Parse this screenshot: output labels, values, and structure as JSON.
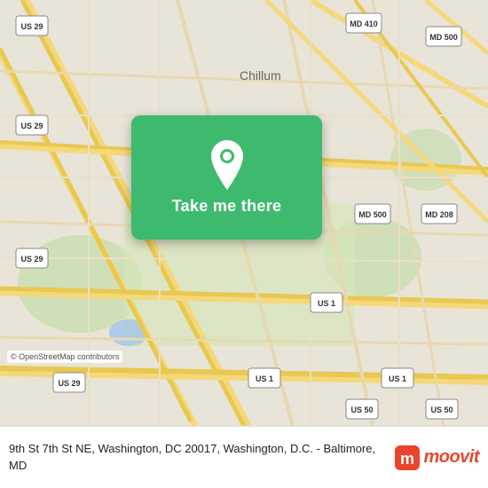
{
  "map": {
    "attribution": "© OpenStreetMap contributors",
    "center_lat": 38.93,
    "center_lng": -77.01
  },
  "card": {
    "button_label": "Take me there",
    "pin_icon": "location-pin"
  },
  "info_bar": {
    "address": "9th St 7th St NE, Washington, DC 20017, Washington, D.C. - Baltimore, MD",
    "moovit_label": "moovit"
  },
  "road_shields": [
    {
      "id": "US-29-top-left",
      "text": "US 29"
    },
    {
      "id": "US-29-mid-left",
      "text": "US 29"
    },
    {
      "id": "US-29-lower-left",
      "text": "US 29"
    },
    {
      "id": "US-29-bottom",
      "text": "US 29"
    },
    {
      "id": "US-1-mid",
      "text": "US 1"
    },
    {
      "id": "US-1-bottom-mid",
      "text": "US 1"
    },
    {
      "id": "US-1-bottom-right",
      "text": "US 1"
    },
    {
      "id": "US-50-bottom",
      "text": "US 50"
    },
    {
      "id": "US-50-bottom2",
      "text": "US 50"
    },
    {
      "id": "MD-410",
      "text": "MD 410"
    },
    {
      "id": "MD-500-top",
      "text": "MD 500"
    },
    {
      "id": "MD-500-mid",
      "text": "MD 500"
    },
    {
      "id": "MD-208",
      "text": "MD 208"
    }
  ]
}
